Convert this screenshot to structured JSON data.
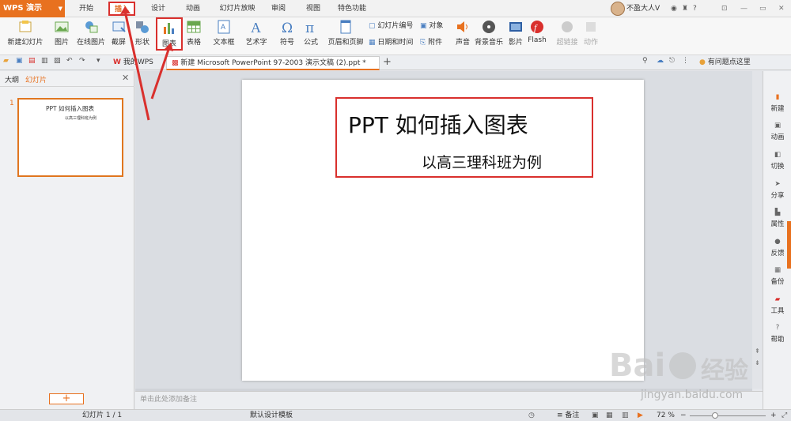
{
  "app": {
    "logo": "WPS 演示"
  },
  "menu": {
    "items": [
      "开始",
      "插入",
      "设计",
      "动画",
      "幻灯片放映",
      "审阅",
      "视图",
      "特色功能"
    ],
    "active": "插入"
  },
  "user": {
    "name": "不盈大人V"
  },
  "ribbon": {
    "new_slide": "新建幻灯片",
    "picture": "图片",
    "online_picture": "在线图片",
    "screenshot": "截屏",
    "shape": "形状",
    "chart": "图表",
    "table": "表格",
    "textbox": "文本框",
    "wordart": "艺术字",
    "symbol": "符号",
    "formula": "公式",
    "header_footer": "页眉和页脚",
    "slide_number": "幻灯片编号",
    "object": "对象",
    "date_time": "日期和时间",
    "attachment": "附件",
    "audio": "声音",
    "bg_music": "背景音乐",
    "movie": "影片",
    "flash": "Flash",
    "hyperlink": "超链接",
    "action": "动作"
  },
  "tabs": {
    "mywps": "我的WPS",
    "document": "新建 Microsoft PowerPoint 97-2003 演示文稿 (2).ppt *",
    "new_tab": "+",
    "help": "有问题点这里"
  },
  "leftpanel": {
    "tab_outline": "大纲",
    "tab_slides": "幻灯片",
    "slide_number": "1",
    "thumb_title": "PPT 如何插入图表",
    "thumb_subtitle": "以高三理科班为例"
  },
  "slide": {
    "title": "PPT 如何插入图表",
    "subtitle": "以高三理科班为例"
  },
  "notes": {
    "placeholder": "单击此处添加备注"
  },
  "sidebar": {
    "items": [
      "新建",
      "动画",
      "切换",
      "分享",
      "属性",
      "反馈",
      "备份",
      "工具",
      "帮助"
    ]
  },
  "status": {
    "slide_info": "幻灯片 1 / 1",
    "template": "默认设计模板",
    "notes_btn": "备注",
    "zoom": "72 %"
  },
  "watermark": {
    "brand": "Bai",
    "brand2": "经验",
    "url": "jingyan.baidu.com"
  },
  "colors": {
    "accent": "#e8711f",
    "highlight": "#d9302d"
  }
}
